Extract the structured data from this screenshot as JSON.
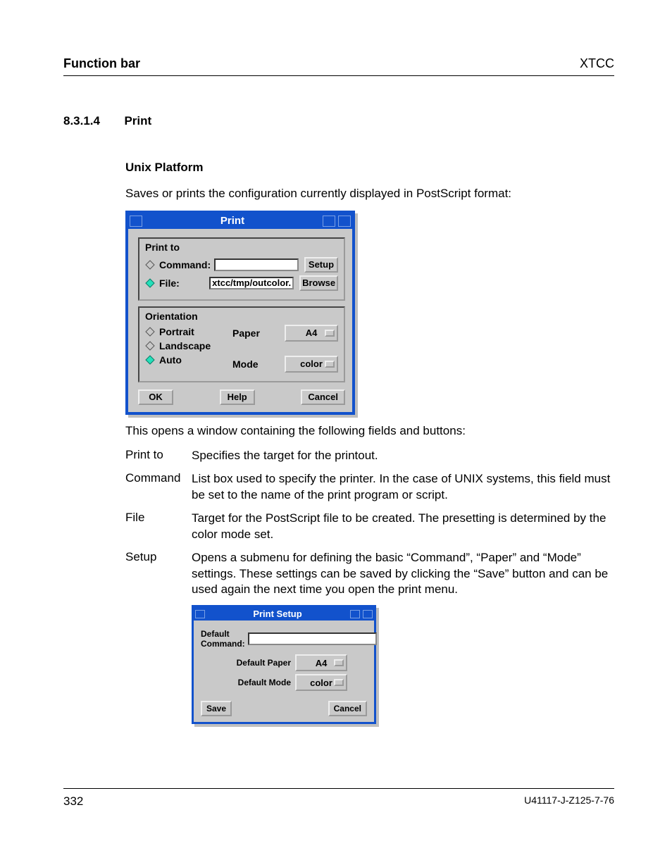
{
  "header": {
    "left": "Function bar",
    "right": "XTCC"
  },
  "section": {
    "num": "8.3.1.4",
    "title": "Print"
  },
  "unix_heading": "Unix Platform",
  "para1": "Saves or prints the configuration currently displayed in PostScript format:",
  "dlg1": {
    "title": "Print",
    "print_to": "Print to",
    "command": "Command:",
    "file": "File:",
    "file_value": "xtcc/tmp/outcolor.ps",
    "setup": "Setup",
    "browse": "Browse",
    "orientation": "Orientation",
    "portrait": "Portrait",
    "landscape": "Landscape",
    "auto": "Auto",
    "paper_label": "Paper",
    "paper_value": "A4",
    "mode_label": "Mode",
    "mode_value": "color",
    "ok": "OK",
    "help": "Help",
    "cancel": "Cancel"
  },
  "para2": "This opens a window containing the following fields and buttons:",
  "defs": [
    {
      "term": "Print to",
      "desc": "Specifies the target for the printout."
    },
    {
      "term": "Command",
      "desc": "List box used to specify the printer. In the case of UNIX systems, this field must be set to the name of the print program or script."
    },
    {
      "term": "File",
      "desc": "Target for the PostScript file to be created. The presetting is determined by the color mode set."
    },
    {
      "term": "Setup",
      "desc": "Opens a submenu for defining the basic “Command”, “Paper” and “Mode” settings. These settings can be saved by clicking the “Save” button and can be used again the next time you open the print menu."
    }
  ],
  "dlg2": {
    "title": "Print Setup",
    "cmd_label": "Default Command:",
    "cmd_value": "",
    "paper_label": "Default Paper",
    "paper_value": "A4",
    "mode_label": "Default Mode",
    "mode_value": "color",
    "save": "Save",
    "cancel": "Cancel"
  },
  "footer": {
    "pagenum": "332",
    "docid": "U41117-J-Z125-7-76"
  }
}
